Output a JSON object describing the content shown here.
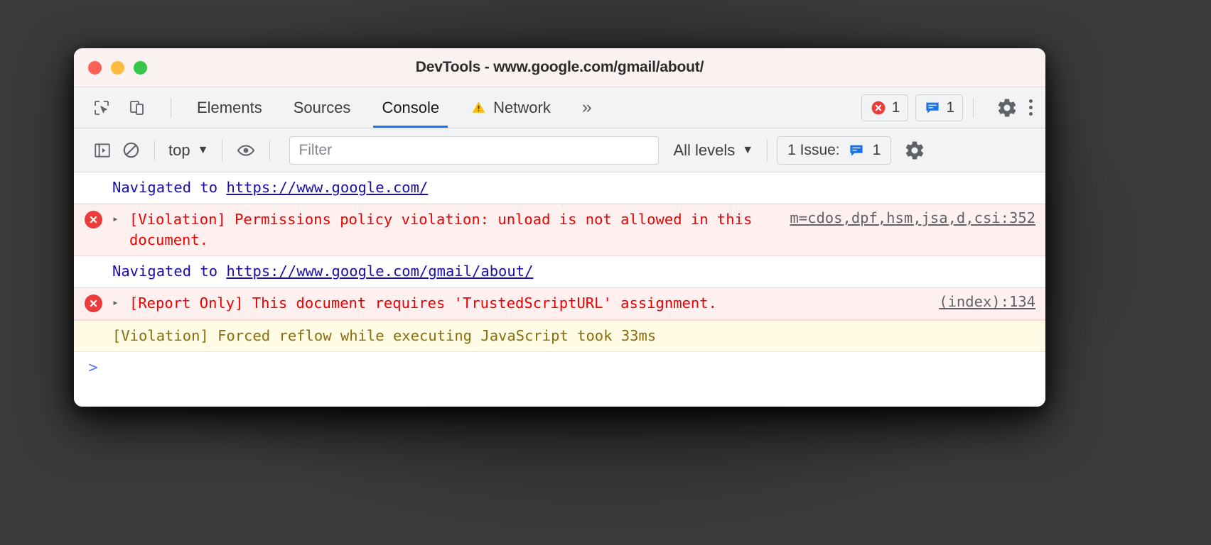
{
  "window": {
    "title": "DevTools - www.google.com/gmail/about/",
    "traffic_lights": [
      "close",
      "minimize",
      "maximize"
    ]
  },
  "tabbar": {
    "inspect_icon": "inspect-cursor-icon",
    "device_icon": "device-toolbar-icon",
    "tabs": [
      {
        "label": "Elements",
        "active": false,
        "warning": false
      },
      {
        "label": "Sources",
        "active": false,
        "warning": false
      },
      {
        "label": "Console",
        "active": true,
        "warning": false
      },
      {
        "label": "Network",
        "active": false,
        "warning": true
      }
    ],
    "more_tabs": "»",
    "error_badge": {
      "icon": "error-circle-icon",
      "count": "1"
    },
    "issue_badge": {
      "icon": "issue-message-icon",
      "count": "1"
    },
    "settings_icon": "gear-icon",
    "menu_icon": "kebab-menu-icon"
  },
  "console_toolbar": {
    "sidebar_icon": "console-sidebar-icon",
    "clear_icon": "clear-console-icon",
    "context": {
      "label": "top",
      "arrow": "▼"
    },
    "eye_icon": "live-expression-eye-icon",
    "filter": {
      "placeholder": "Filter",
      "value": ""
    },
    "levels": {
      "label": "All levels",
      "arrow": "▼"
    },
    "issues": {
      "label": "1 Issue:",
      "icon": "issue-message-icon",
      "count": "1"
    },
    "settings_icon": "gear-icon"
  },
  "console_rows": [
    {
      "type": "info",
      "prefix": "Navigated to ",
      "link": "https://www.google.com/",
      "source": ""
    },
    {
      "type": "error",
      "icon": "error-circle-icon",
      "expand": "▸",
      "text": "[Violation] Permissions policy violation: unload is not allowed in this document.",
      "source": "m=cdos,dpf,hsm,jsa,d,csi:352"
    },
    {
      "type": "info",
      "prefix": "Navigated to ",
      "link": "https://www.google.com/gmail/about/",
      "source": ""
    },
    {
      "type": "error",
      "icon": "error-circle-icon",
      "expand": "▸",
      "text": "[Report Only] This document requires 'TrustedScriptURL' assignment.",
      "source": "(index):134"
    },
    {
      "type": "warn",
      "text": "[Violation] Forced reflow while executing JavaScript took 33ms",
      "source": ""
    }
  ],
  "prompt": {
    "chevron": ">",
    "value": ""
  },
  "colors": {
    "accent": "#1a73e8",
    "error_text": "#ef0000",
    "error_bg": "#fff0f0",
    "warn_text": "#8a6d0b",
    "warn_bg": "#fffbe5",
    "link": "#1a0dab",
    "titlebar_bg": "#faf2f0",
    "toolbar_bg": "#f1f3f4"
  }
}
